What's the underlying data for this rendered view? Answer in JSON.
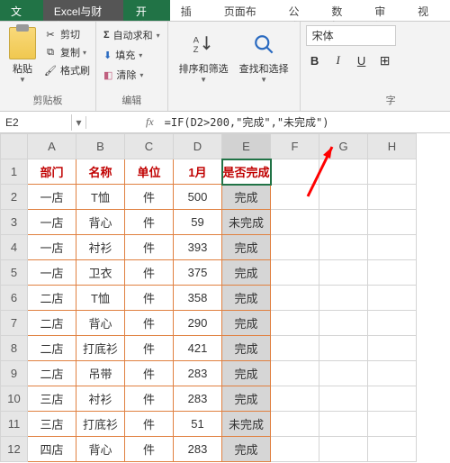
{
  "menubar": {
    "file": "文件",
    "addon": "Excel与财务",
    "tabs": [
      "开始",
      "插入",
      "页面布局",
      "公式",
      "数据",
      "审阅",
      "视图"
    ]
  },
  "ribbon": {
    "clipboard": {
      "paste": "粘贴",
      "cut": "剪切",
      "copy": "复制",
      "formatPainter": "格式刷",
      "group": "剪贴板"
    },
    "edit": {
      "autosum": "自动求和",
      "fill": "填充",
      "clear": "清除",
      "group": "编辑"
    },
    "sort": "排序和筛选",
    "find": "查找和选择",
    "font": {
      "name": "宋体",
      "group": "字"
    }
  },
  "namebox": "E2",
  "formula": "=IF(D2>200,\"完成\",\"未完成\")",
  "chart_data": {
    "type": "table",
    "headers": [
      "部门",
      "名称",
      "单位",
      "1月",
      "是否完成"
    ],
    "col_letters": [
      "A",
      "B",
      "C",
      "D",
      "E",
      "F",
      "G",
      "H"
    ],
    "rows": [
      {
        "r": 1
      },
      {
        "r": 2,
        "部门": "一店",
        "名称": "T恤",
        "单位": "件",
        "1月": 500,
        "是否完成": "完成"
      },
      {
        "r": 3,
        "部门": "一店",
        "名称": "背心",
        "单位": "件",
        "1月": 59,
        "是否完成": "未完成"
      },
      {
        "r": 4,
        "部门": "一店",
        "名称": "衬衫",
        "单位": "件",
        "1月": 393,
        "是否完成": "完成"
      },
      {
        "r": 5,
        "部门": "一店",
        "名称": "卫衣",
        "单位": "件",
        "1月": 375,
        "是否完成": "完成"
      },
      {
        "r": 6,
        "部门": "二店",
        "名称": "T恤",
        "单位": "件",
        "1月": 358,
        "是否完成": "完成"
      },
      {
        "r": 7,
        "部门": "二店",
        "名称": "背心",
        "单位": "件",
        "1月": 290,
        "是否完成": "完成"
      },
      {
        "r": 8,
        "部门": "二店",
        "名称": "打底衫",
        "单位": "件",
        "1月": 421,
        "是否完成": "完成"
      },
      {
        "r": 9,
        "部门": "二店",
        "名称": "吊带",
        "单位": "件",
        "1月": 283,
        "是否完成": "完成"
      },
      {
        "r": 10,
        "部门": "三店",
        "名称": "衬衫",
        "单位": "件",
        "1月": 283,
        "是否完成": "完成"
      },
      {
        "r": 11,
        "部门": "三店",
        "名称": "打底衫",
        "单位": "件",
        "1月": 51,
        "是否完成": "未完成"
      },
      {
        "r": 12,
        "部门": "四店",
        "名称": "背心",
        "单位": "件",
        "1月": 283,
        "是否完成": "完成"
      }
    ]
  }
}
